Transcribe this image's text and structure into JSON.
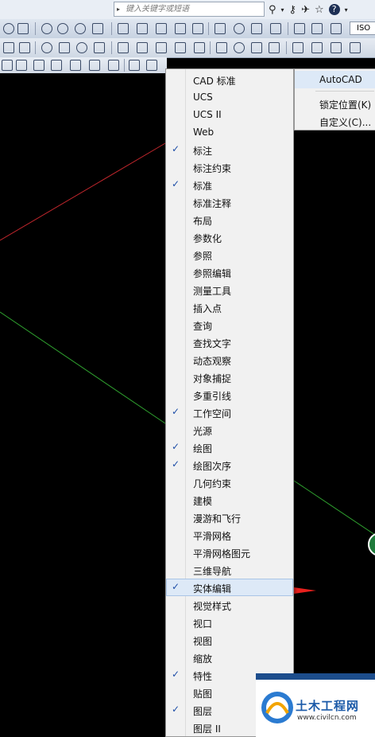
{
  "search": {
    "placeholder": "键入关键字或短语"
  },
  "toolbar_right": {
    "workspace_text": "ISO"
  },
  "menu": {
    "items": [
      {
        "label": "CAD 标准",
        "checked": false
      },
      {
        "label": "UCS",
        "checked": false
      },
      {
        "label": "UCS II",
        "checked": false
      },
      {
        "label": "Web",
        "checked": false
      },
      {
        "label": "标注",
        "checked": true
      },
      {
        "label": "标注约束",
        "checked": false
      },
      {
        "label": "标准",
        "checked": true
      },
      {
        "label": "标准注释",
        "checked": false
      },
      {
        "label": "布局",
        "checked": false
      },
      {
        "label": "参数化",
        "checked": false
      },
      {
        "label": "参照",
        "checked": false
      },
      {
        "label": "参照编辑",
        "checked": false
      },
      {
        "label": "测量工具",
        "checked": false
      },
      {
        "label": "插入点",
        "checked": false
      },
      {
        "label": "查询",
        "checked": false
      },
      {
        "label": "查找文字",
        "checked": false
      },
      {
        "label": "动态观察",
        "checked": false
      },
      {
        "label": "对象捕捉",
        "checked": false
      },
      {
        "label": "多重引线",
        "checked": false
      },
      {
        "label": "工作空间",
        "checked": true
      },
      {
        "label": "光源",
        "checked": false
      },
      {
        "label": "绘图",
        "checked": true
      },
      {
        "label": "绘图次序",
        "checked": true
      },
      {
        "label": "几何约束",
        "checked": false
      },
      {
        "label": "建模",
        "checked": false
      },
      {
        "label": "漫游和飞行",
        "checked": false
      },
      {
        "label": "平滑网格",
        "checked": false
      },
      {
        "label": "平滑网格图元",
        "checked": false
      },
      {
        "label": "三维导航",
        "checked": false
      },
      {
        "label": "实体编辑",
        "checked": true
      },
      {
        "label": "视觉样式",
        "checked": false
      },
      {
        "label": "视口",
        "checked": false
      },
      {
        "label": "视图",
        "checked": false
      },
      {
        "label": "缩放",
        "checked": false
      },
      {
        "label": "特性",
        "checked": true
      },
      {
        "label": "贴图",
        "checked": false
      },
      {
        "label": "图层",
        "checked": true
      },
      {
        "label": "图层 II",
        "checked": false
      }
    ],
    "highlighted_index": 29,
    "check_glyph": "✓"
  },
  "submenu": {
    "items": [
      {
        "label": "AutoCAD"
      },
      {
        "label": "锁定位置(K)"
      },
      {
        "label": "自定义(C)..."
      }
    ]
  },
  "watermark": {
    "name": "土木工程网",
    "url": "www.civilcn.com"
  },
  "colors": {
    "canvas": "#000000",
    "red_line": "#c0262c",
    "green_line": "#2fa12f",
    "arrow": "#e8201d",
    "highlight": "#dde9f7"
  }
}
